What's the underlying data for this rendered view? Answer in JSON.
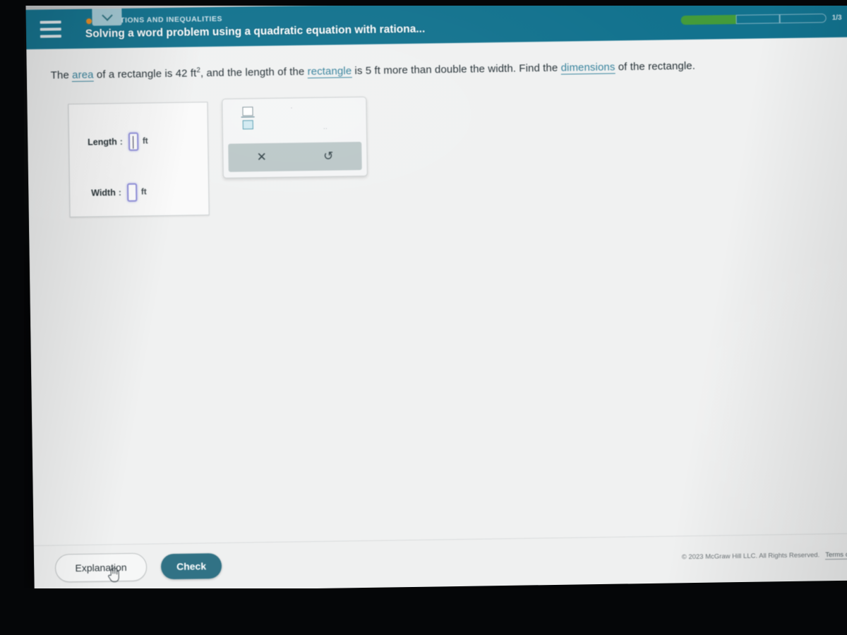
{
  "header": {
    "menu_icon": "hamburger-menu-icon",
    "category_badge_icon": "orange-circle-badge-icon",
    "category": "EQUATIONS AND INEQUALITIES",
    "lesson_title": "Solving a word problem using a quadratic equation with rationa...",
    "progress_label": "1/3",
    "progress_total": 3,
    "progress_completed": 1,
    "accent_color": "#0d7290",
    "progress_fill_color": "#3f9b35",
    "badge_color": "#e8881b"
  },
  "collapse_tab": {
    "icon": "chevron-down-icon"
  },
  "problem": {
    "text_part_1": "The ",
    "link_area": "area",
    "text_part_2": " of a rectangle is 42 ft",
    "exponent": "2",
    "text_part_3": ", and the length of the ",
    "link_rectangle": "rectangle",
    "text_part_4": " is 5 ft more than double the width. Find the ",
    "link_dimensions": "dimensions",
    "text_part_5": " of the rectangle."
  },
  "answer_card": {
    "rows": [
      {
        "label": "Length",
        "colon": ":",
        "value": "",
        "unit": "ft",
        "focused": true
      },
      {
        "label": "Width",
        "colon": ":",
        "value": "",
        "unit": "ft",
        "focused": false
      }
    ]
  },
  "math_toolbar": {
    "fraction_button_icon": "fraction-template-icon",
    "clear_button_label": "✕",
    "undo_button_label": "↺",
    "hint_dot_a": "·",
    "hint_dot_b": "··"
  },
  "footer": {
    "explanation_label": "Explanation",
    "check_label": "Check",
    "copyright": "© 2023 McGraw Hill LLC. All Rights Reserved.",
    "terms_label": "Terms of Us",
    "strip_color": "#2e7084"
  }
}
